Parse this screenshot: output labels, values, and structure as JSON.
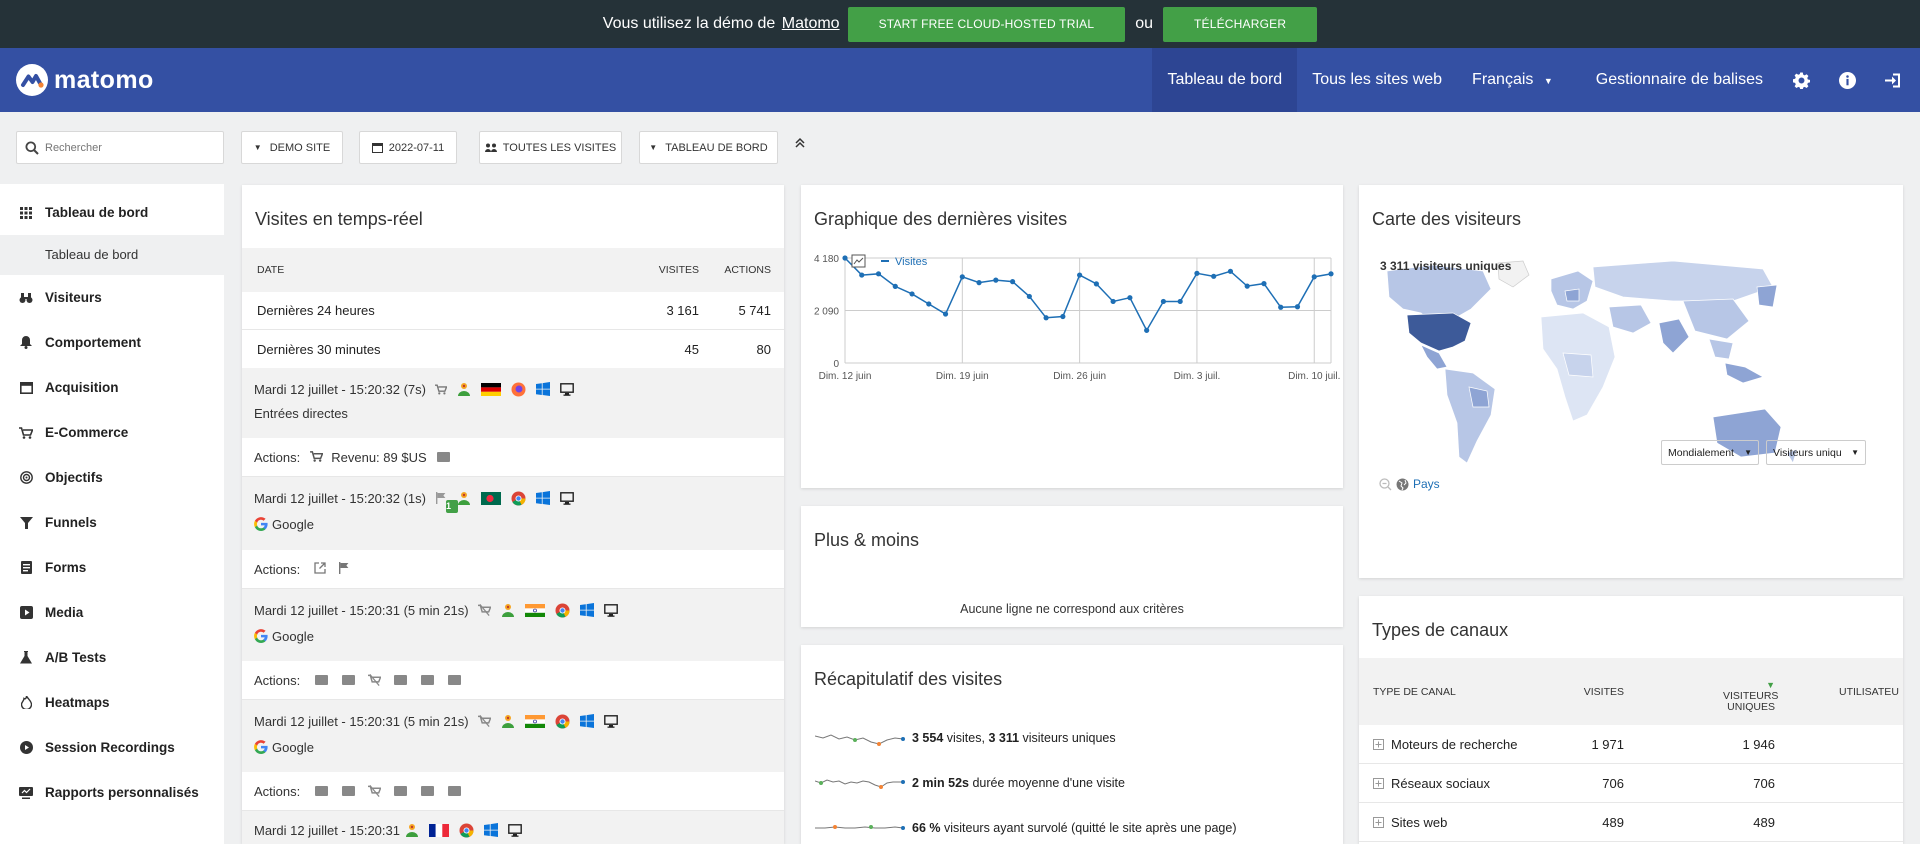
{
  "topbar": {
    "demo_text": "Vous utilisez la démo de",
    "demo_link": "Matomo",
    "trial_button": "START FREE CLOUD-HOSTED TRIAL",
    "or_text": "ou",
    "download_button": "TÉLÉCHARGER"
  },
  "header": {
    "logo": "matomo",
    "nav": [
      "Tableau de bord",
      "Tous les sites web",
      "Français",
      "Gestionnaire de balises"
    ]
  },
  "toolbar": {
    "search_placeholder": "Rechercher",
    "site": "DEMO SITE",
    "date": "2022-07-11",
    "segment": "TOUTES LES VISITES",
    "dashboard": "TABLEAU DE BORD"
  },
  "sidebar": {
    "items": [
      {
        "label": "Tableau de bord",
        "icon": "dashboard-icon"
      },
      {
        "label": "Visiteurs",
        "icon": "binoculars-icon"
      },
      {
        "label": "Comportement",
        "icon": "bell-icon"
      },
      {
        "label": "Acquisition",
        "icon": "acquisition-icon"
      },
      {
        "label": "E-Commerce",
        "icon": "cart-icon"
      },
      {
        "label": "Objectifs",
        "icon": "target-icon"
      },
      {
        "label": "Funnels",
        "icon": "funnel-icon"
      },
      {
        "label": "Forms",
        "icon": "form-icon"
      },
      {
        "label": "Media",
        "icon": "media-icon"
      },
      {
        "label": "A/B Tests",
        "icon": "flask-icon"
      },
      {
        "label": "Heatmaps",
        "icon": "flame-icon"
      },
      {
        "label": "Session Recordings",
        "icon": "record-icon"
      },
      {
        "label": "Rapports personnalisés",
        "icon": "report-icon"
      }
    ],
    "sub_item": "Tableau de bord"
  },
  "realtime": {
    "title": "Visites en temps-réel",
    "headers": [
      "DATE",
      "VISITES",
      "ACTIONS"
    ],
    "rows": [
      {
        "label": "Dernières 24 heures",
        "visits": "3 161",
        "actions": "5 741"
      },
      {
        "label": "Dernières 30 minutes",
        "visits": "45",
        "actions": "80"
      }
    ],
    "visits": [
      {
        "time": "Mardi 12 juillet - 15:20:32 (7s)",
        "referrer": "Entrées directes",
        "actions_label": "Actions:",
        "revenue": "Revenu: 89 $US"
      },
      {
        "time": "Mardi 12 juillet - 15:20:32 (1s)",
        "referrer": "Google",
        "actions_label": "Actions:",
        "badge": "1"
      },
      {
        "time": "Mardi 12 juillet - 15:20:31 (5 min 21s)",
        "referrer": "Google",
        "actions_label": "Actions:"
      },
      {
        "time": "Mardi 12 juillet - 15:20:31 (5 min 21s)",
        "referrer": "Google",
        "actions_label": "Actions:"
      },
      {
        "time": "Mardi 12 juillet - 15:20:31"
      }
    ]
  },
  "graph": {
    "title": "Graphique des dernières visites",
    "legend": "Visites"
  },
  "chart_data": {
    "type": "line",
    "series": [
      {
        "name": "Visites",
        "values": [
          4180,
          3500,
          3550,
          3050,
          2750,
          2350,
          1950,
          3430,
          3200,
          3300,
          3240,
          2650,
          1800,
          1850,
          3500,
          3150,
          2450,
          2600,
          1300,
          2450,
          2450,
          3570,
          3450,
          3650,
          3060,
          3160,
          2220,
          2240,
          3430,
          3550
        ]
      }
    ],
    "xticklabels": [
      "Dim. 12 juin",
      "Dim. 19 juin",
      "Dim. 26 juin",
      "Dim. 3 juil.",
      "Dim. 10 juil."
    ],
    "yticklabels": [
      "4 180",
      "2 090",
      "0"
    ],
    "ylim": [
      0,
      4180
    ]
  },
  "plusmoins": {
    "title": "Plus & moins",
    "empty": "Aucune ligne ne correspond aux critères"
  },
  "recap": {
    "title": "Récapitulatif des visites",
    "line1_a": "3 554",
    "line1_b": " visites, ",
    "line1_c": "3 311",
    "line1_d": " visiteurs uniques",
    "line2_a": "2 min 52s",
    "line2_b": " durée moyenne d'une visite",
    "line3_a": "66 %",
    "line3_b": " visiteurs ayant survolé (quitté le site après une page)"
  },
  "map": {
    "title": "Carte des visiteurs",
    "unique_visitors": "3 311 visiteurs uniques",
    "pays": "Pays",
    "scope": "Mondialement",
    "metric": "Visiteurs uniqu"
  },
  "channels": {
    "title": "Types de canaux",
    "headers": [
      "TYPE DE CANAL",
      "VISITES",
      "VISITEURS UNIQUES",
      "UTILISATEU"
    ],
    "rows": [
      {
        "label": "Moteurs de recherche",
        "visits": "1 971",
        "unique": "1 946"
      },
      {
        "label": "Réseaux sociaux",
        "visits": "706",
        "unique": "706"
      },
      {
        "label": "Sites web",
        "visits": "489",
        "unique": "489"
      }
    ]
  },
  "colors": {
    "header": "#3450a3",
    "topbar": "#253238",
    "accent_green": "#43a047",
    "line": "#1e6fb5"
  }
}
